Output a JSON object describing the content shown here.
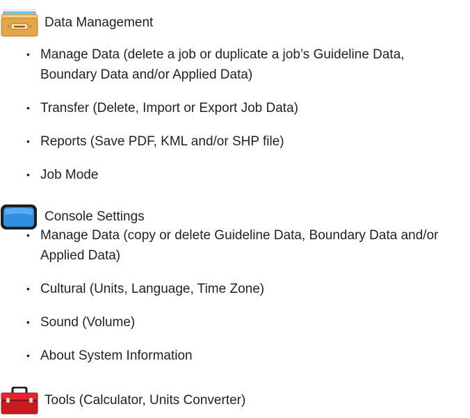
{
  "sections": [
    {
      "title": "Data Management",
      "icon": "file-box-icon",
      "items": [
        "Manage Data (delete a job or duplicate a job’s Guideline Data, Boundary Data and/or Applied Data)",
        "Transfer (Delete, Import or Export Job Data)",
        "Reports (Save PDF, KML and/or SHP file)",
        "Job Mode"
      ]
    },
    {
      "title": "Console Settings",
      "icon": "blue-screen-icon",
      "items": [
        "Manage Data (copy or delete Guideline Data, Boundary Data and/or Applied Data)",
        "Cultural (Units, Language, Time Zone)",
        "Sound (Volume)",
        "About System Information"
      ]
    },
    {
      "title": "Tools (Calculator, Units Converter)",
      "icon": "red-toolbox-icon",
      "items": []
    }
  ],
  "bullet_glyph": "•",
  "colors": {
    "text": "#231f20",
    "box_tan": "#e3a64a",
    "screen_blue": "#2f8fe0",
    "toolbox_red": "#d81e24"
  }
}
